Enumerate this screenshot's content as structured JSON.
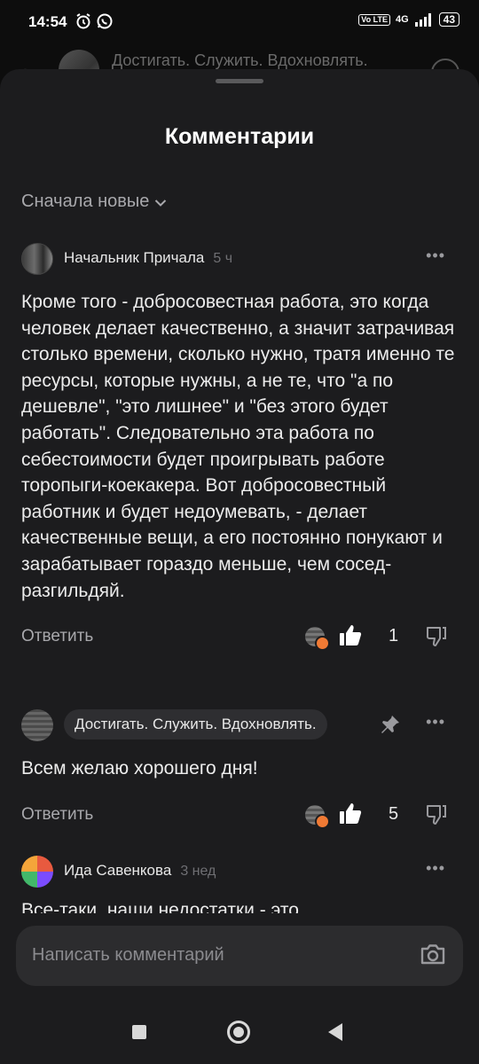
{
  "status": {
    "time": "14:54",
    "network": "4G",
    "battery": "43",
    "volte": "Vo LTE"
  },
  "background": {
    "channel_title": "Достигать. Служить. Вдохновлять."
  },
  "sheet": {
    "title": "Комментарии",
    "sort_label": "Сначала новые"
  },
  "comments": [
    {
      "author": "Начальник Причала",
      "age": "5 ч",
      "text": "Кроме того - добросовестная работа, это когда человек делает качественно, а значит затрачивая столько времени, сколько нужно, тратя именно те ресурсы, которые нужны, а не те, что \"а по дешевле\", \"это лишнее\" и \"без этого будет работать\". Следовательно эта работа по себестоимости будет проигрывать работе торопыги-коекакера. Вот добросовестный работник и будет недоумевать, - делает качественные вещи, а его постоянно понукают и зарабатывает гораздо меньше, чем сосед-разгильдяй.",
      "reply_label": "Ответить",
      "likes": "1"
    },
    {
      "author": "Достигать. Служить. Вдохновлять.",
      "text": "Всем желаю хорошего дня!",
      "reply_label": "Ответить",
      "likes": "5"
    },
    {
      "author": "Ида Савенкова",
      "age": "3 нед",
      "text_partial": "Все-таки, наши недостатки - это"
    }
  ],
  "composer": {
    "placeholder": "Написать комментарий"
  },
  "icons": {
    "more": "more-horizontal-icon",
    "pin": "pin-icon",
    "like": "thumbs-up-icon",
    "dislike": "thumbs-down-icon",
    "camera": "camera-icon",
    "chevron": "chevron-down-icon"
  }
}
